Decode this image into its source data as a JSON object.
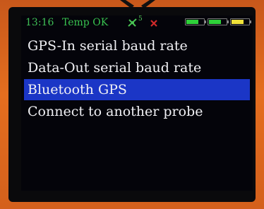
{
  "status_bar": {
    "time": "13:16",
    "temp_status": "Temp OK",
    "satellite_icon": "satellite-icon",
    "satellite_count": "5",
    "no_signal_icon": "cross-icon",
    "batteries": [
      {
        "icon": "battery-icon",
        "level": 0.7,
        "color": "#2fd13a"
      },
      {
        "icon": "battery-icon",
        "level": 0.7,
        "color": "#2fd13a"
      },
      {
        "icon": "battery-icon",
        "level": 0.7,
        "color": "#f0e23a"
      }
    ]
  },
  "menu": {
    "items": [
      {
        "label": "GPS-In serial baud rate",
        "selected": false
      },
      {
        "label": "Data-Out serial baud rate",
        "selected": false
      },
      {
        "label": "Bluetooth GPS",
        "selected": true
      },
      {
        "label": "Connect to another probe",
        "selected": false
      }
    ]
  },
  "colors": {
    "accent": "#1b36c6",
    "status_ok": "#38c24f",
    "alert": "#d22a2a",
    "frame": "#d9651a"
  }
}
